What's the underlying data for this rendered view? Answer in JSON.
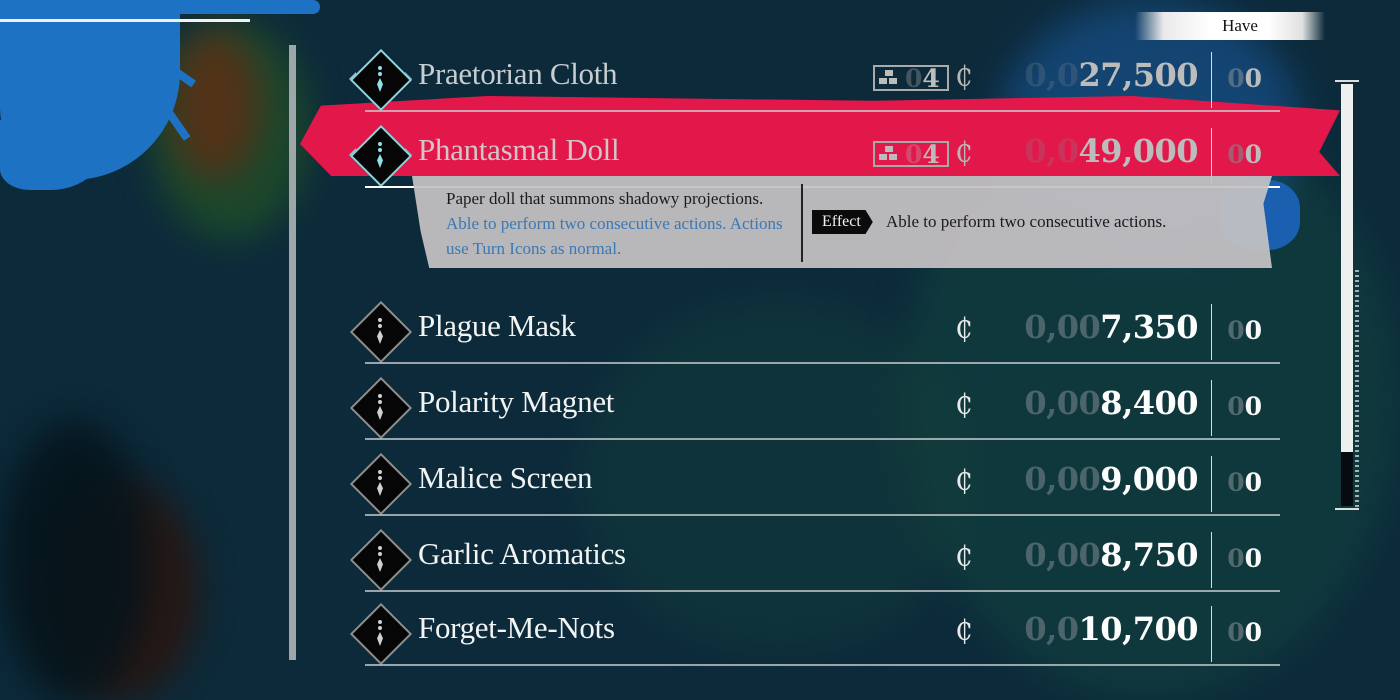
{
  "header": {
    "have_label": "Have"
  },
  "currency_symbol": "₵",
  "items": [
    {
      "name": "Praetorian Cloth",
      "tag_value": "4",
      "tag_pad": "0",
      "price_pad": "0,0",
      "price": "27,500",
      "have_pad": "0",
      "have": "0",
      "state": "top"
    },
    {
      "name": "Phantasmal Doll",
      "tag_value": "4",
      "tag_pad": "0",
      "price_pad": "0,0",
      "price": "49,000",
      "have_pad": "0",
      "have": "0",
      "state": "selected"
    },
    {
      "name": "Plague Mask",
      "price_pad": "0,00",
      "price": "7,350",
      "have_pad": "0",
      "have": "0"
    },
    {
      "name": "Polarity Magnet",
      "price_pad": "0,00",
      "price": "8,400",
      "have_pad": "0",
      "have": "0"
    },
    {
      "name": "Malice Screen",
      "price_pad": "0,00",
      "price": "9,000",
      "have_pad": "0",
      "have": "0"
    },
    {
      "name": "Garlic Aromatics",
      "price_pad": "0,00",
      "price": "8,750",
      "have_pad": "0",
      "have": "0"
    },
    {
      "name": "Forget-Me-Nots",
      "price_pad": "0,0",
      "price": "10,700",
      "have_pad": "0",
      "have": "0"
    }
  ],
  "description": {
    "text_plain": "Paper doll that summons shadowy projections. ",
    "text_highlight": "Able to perform two consecutive actions. Actions use Turn Icons as normal.",
    "effect_label": "Effect",
    "effect_text": "Able to perform two consecutive actions."
  },
  "scroll": {
    "position_fraction": 0.88
  },
  "colors": {
    "highlight": "#e3184a",
    "accent_cyan": "#8cd3dc",
    "desc_highlight": "#3b78b5"
  }
}
